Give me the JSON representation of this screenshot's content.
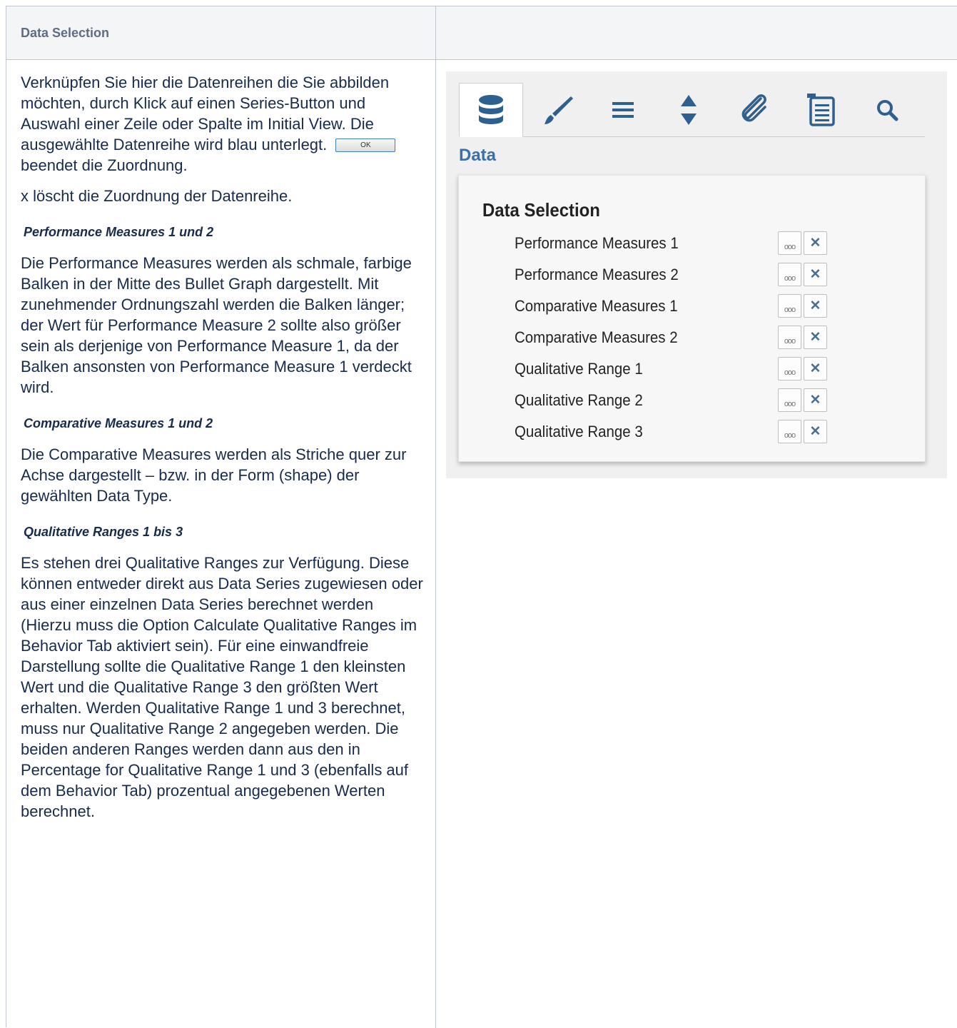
{
  "header": {
    "col1": "Data Selection"
  },
  "content": {
    "intro_part1": "Verknüpfen Sie hier die Datenreihen die Sie abbilden möchten, durch Klick auf einen Series-Button und Auswahl einer Zeile oder Spalte im Initial View. Die ausgewählte Datenreihe wird blau unterlegt.",
    "ok_label": "OK",
    "intro_part2": "beendet die Zuordnung.",
    "x_note": "x löscht die Zuordnung der Datenreihe.",
    "sections": [
      {
        "title": "Performance Measures 1 und 2",
        "text": "Die Performance Measures werden als schmale, farbige Balken in der Mitte des Bullet Graph dargestellt. Mit zunehmender Ordnungszahl werden die Balken länger; der Wert für Performance Measure 2 sollte also größer sein als derjenige von Performance Measure 1, da der Balken ansonsten von Performance Measure 1 verdeckt wird."
      },
      {
        "title": "Comparative Measures 1 und 2",
        "text": "Die Comparative Measures werden als Striche quer zur Achse dargestellt – bzw. in der Form (shape) der gewählten Data Type."
      },
      {
        "title": "Qualitative Ranges 1 bis 3",
        "text": "Es stehen drei Qualitative Ranges zur Verfügung. Diese können entweder direkt aus Data Series zugewiesen oder aus einer einzelnen Data Series berechnet werden (Hierzu muss die Option Calculate Qualitative Ranges im Behavior Tab aktiviert sein). Für eine einwandfreie Darstellung sollte die Qualitative Range 1 den kleinsten Wert und die Qualitative Range 3 den größten Wert erhalten. Werden Qualitative Range 1 und 3 berechnet, muss nur Qualitative Range 2 angegeben werden. Die beiden anderen Ranges werden dann aus den in Percentage for Qualitative Range 1 und 3 (ebenfalls auf dem Behavior Tab) prozentual angegebenen Werten berechnet."
      }
    ]
  },
  "panel": {
    "tabs": [
      {
        "icon": "database-icon",
        "active": true
      },
      {
        "icon": "brush-icon",
        "active": false
      },
      {
        "icon": "menu-lines-icon",
        "active": false
      },
      {
        "icon": "sort-arrows-icon",
        "active": false
      },
      {
        "icon": "paperclip-icon",
        "active": false
      },
      {
        "icon": "numbered-list-icon",
        "active": false
      },
      {
        "icon": "search-icon",
        "active": false
      }
    ],
    "heading": "Data",
    "card_title": "Data Selection",
    "rows": [
      {
        "label": "Performance Measures 1"
      },
      {
        "label": "Performance Measures 2"
      },
      {
        "label": "Comparative Measures 1"
      },
      {
        "label": "Comparative Measures 2"
      },
      {
        "label": "Qualitative Range 1"
      },
      {
        "label": "Qualitative Range 2"
      },
      {
        "label": "Qualitative Range 3"
      }
    ],
    "more_glyph": "ooo",
    "clear_glyph": "✕",
    "colors": {
      "icon_blue": "#2d5f8f",
      "heading_blue": "#3a6fa8"
    }
  }
}
